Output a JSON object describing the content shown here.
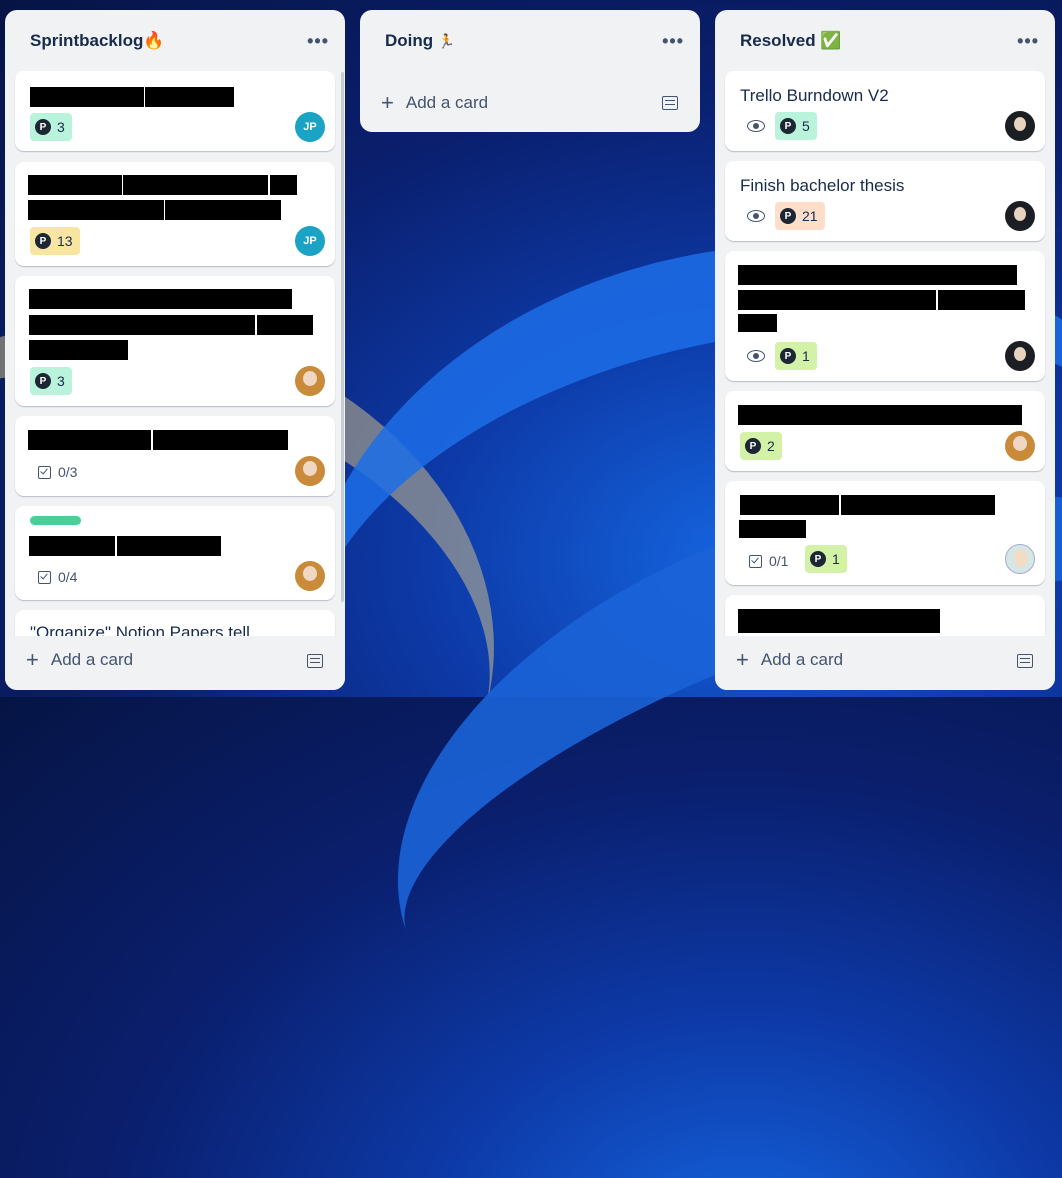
{
  "lists": [
    {
      "title": "Sprintbacklog",
      "emoji": "🔥",
      "add_label": "Add a card",
      "cards": [
        {
          "points": "3",
          "avatar": "JP"
        },
        {
          "points": "13",
          "avatar": "JP"
        },
        {
          "points": "3"
        },
        {
          "checklist": "0/3"
        },
        {
          "checklist": "0/4"
        },
        {
          "partial_title": "\"Organize\" Notion Papers tell"
        }
      ]
    },
    {
      "title": "Doing",
      "emoji": "🏃",
      "add_label": "Add a card",
      "cards": []
    },
    {
      "title": "Resolved",
      "emoji": "✅",
      "add_label": "Add a card",
      "cards": [
        {
          "title": "Trello Burndown V2",
          "points": "5"
        },
        {
          "title": "Finish bachelor thesis",
          "points": "21"
        },
        {
          "points": "1"
        },
        {
          "points": "2"
        },
        {
          "checklist": "0/1",
          "points": "1"
        }
      ]
    }
  ],
  "icons": {
    "points": "P",
    "more": "•••",
    "plus": "+"
  },
  "colors": {
    "badge_teal": "#baf3db",
    "badge_yellow": "#f8e6a0",
    "badge_orange": "#fedec8",
    "badge_lime": "#d3f1a7",
    "label_green": "#4bce97"
  }
}
